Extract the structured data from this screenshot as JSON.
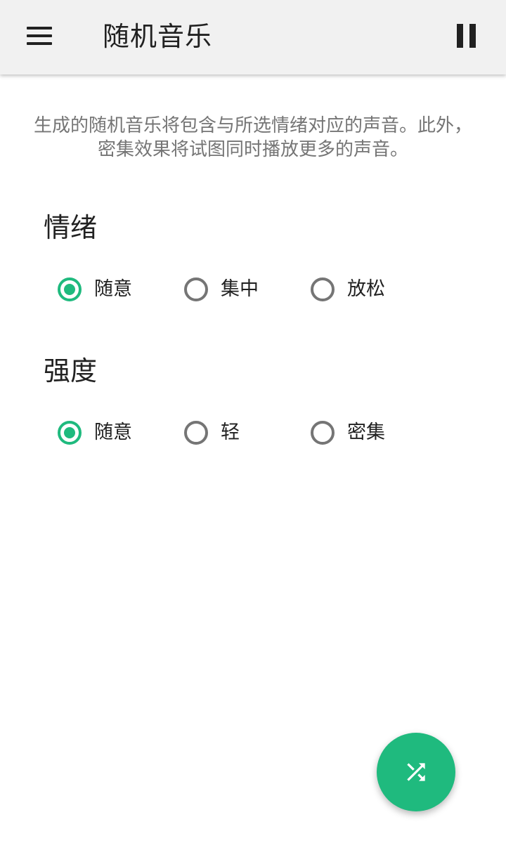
{
  "header": {
    "title": "随机音乐"
  },
  "description": "生成的随机音乐将包含与所选情绪对应的声音。此外，密集效果将试图同时播放更多的声音。",
  "mood": {
    "title": "情绪",
    "options": [
      {
        "label": "随意",
        "checked": true
      },
      {
        "label": "集中",
        "checked": false
      },
      {
        "label": "放松",
        "checked": false
      }
    ]
  },
  "intensity": {
    "title": "强度",
    "options": [
      {
        "label": "随意",
        "checked": true
      },
      {
        "label": "轻",
        "checked": false
      },
      {
        "label": "密集",
        "checked": false
      }
    ]
  },
  "icons": {
    "menu": "menu-icon",
    "pause": "pause-icon",
    "fab": "shuffle-icon"
  },
  "colors": {
    "accent": "#1fba7e",
    "appbar": "#f1f1f1",
    "text_primary": "#212121",
    "text_secondary": "#757575"
  }
}
